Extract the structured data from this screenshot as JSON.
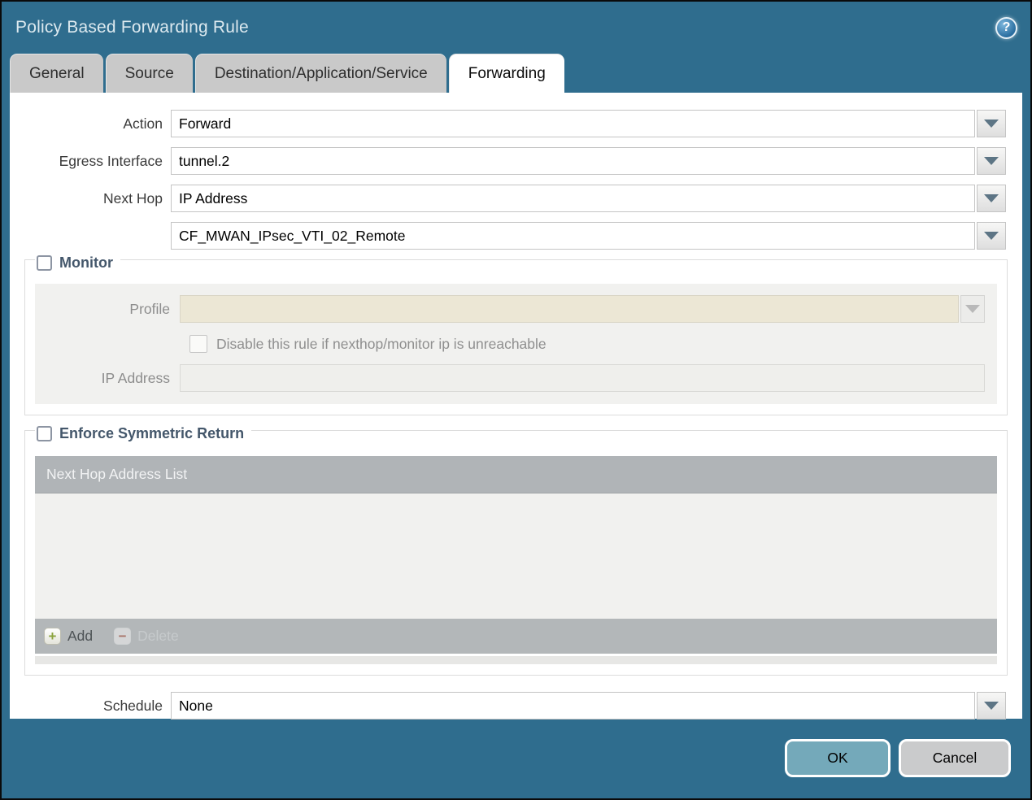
{
  "dialog": {
    "title": "Policy Based Forwarding Rule",
    "help_glyph": "?"
  },
  "tabs": [
    {
      "label": "General",
      "active": false
    },
    {
      "label": "Source",
      "active": false
    },
    {
      "label": "Destination/Application/Service",
      "active": false
    },
    {
      "label": "Forwarding",
      "active": true
    }
  ],
  "form": {
    "action": {
      "label": "Action",
      "value": "Forward"
    },
    "egress_interface": {
      "label": "Egress Interface",
      "value": "tunnel.2"
    },
    "next_hop": {
      "label": "Next Hop",
      "value": "IP Address"
    },
    "next_hop_address": {
      "value": "CF_MWAN_IPsec_VTI_02_Remote"
    },
    "schedule": {
      "label": "Schedule",
      "value": "None"
    }
  },
  "monitor": {
    "legend": "Monitor",
    "checked": false,
    "profile_label": "Profile",
    "profile_value": "",
    "disable_checkbox_label": "Disable this rule if nexthop/monitor ip is unreachable",
    "disable_checkbox_checked": false,
    "ip_address_label": "IP Address",
    "ip_address_value": ""
  },
  "symmetric_return": {
    "legend": "Enforce Symmetric Return",
    "checked": false,
    "table_header": "Next Hop Address List",
    "rows": [],
    "add_label": "Add",
    "add_icon_glyph": "+",
    "delete_label": "Delete",
    "delete_icon_glyph": "−",
    "delete_enabled": false
  },
  "footer": {
    "ok_label": "OK",
    "cancel_label": "Cancel"
  },
  "colors": {
    "dialog_background": "#2f6d8e",
    "panel_background": "#ffffff",
    "tab_inactive": "#c9c9c9",
    "grid_header": "#b0b4b7",
    "disabled_field_beige": "#ece7d5",
    "disabled_panel": "#f1f1ef",
    "ok_button": "#74a9ba",
    "cancel_button": "#cacbcc",
    "legend_text": "#44576b",
    "dropdown_arrow": "#5d7585"
  }
}
